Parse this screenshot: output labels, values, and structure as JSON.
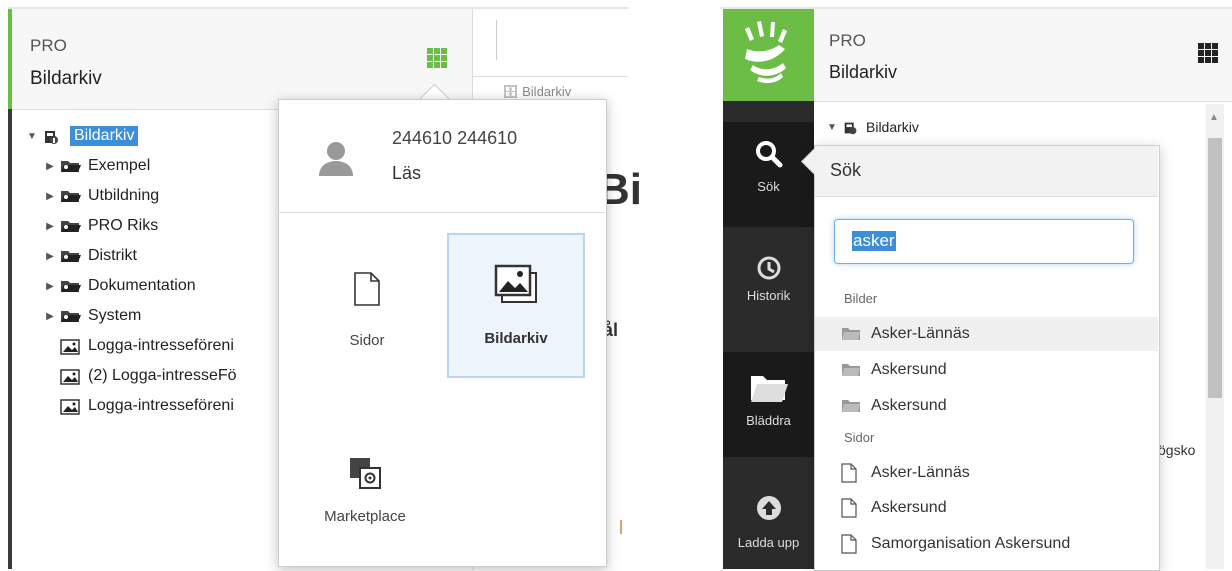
{
  "left": {
    "header": {
      "title": "PRO",
      "subtitle": "Bildarkiv"
    },
    "breadcrumb": "Bildarkiv",
    "tree": {
      "root": "Bildarkiv",
      "folders": [
        "Exempel",
        "Utbildning",
        "PRO Riks",
        "Distrikt",
        "Dokumentation",
        "System"
      ],
      "images": [
        "Logga-intresseföreni",
        "(2) Logga-intresseFö",
        "Logga-intresseföreni"
      ]
    },
    "page_heading_partial": "Bi",
    "table_col_partial": "ål",
    "popover": {
      "user": "244610 244610",
      "role": "Läs",
      "apps": [
        {
          "label": "Sidor",
          "icon": "page-icon",
          "active": false
        },
        {
          "label": "Bildarkiv",
          "icon": "images-icon",
          "active": true
        },
        {
          "label": "Marketplace",
          "icon": "marketplace-icon",
          "active": false
        }
      ]
    }
  },
  "right": {
    "header": {
      "title": "PRO",
      "subtitle": "Bildarkiv"
    },
    "nav": [
      {
        "label": "Sök",
        "icon": "search-icon"
      },
      {
        "label": "Historik",
        "icon": "history-icon"
      },
      {
        "label": "Bläddra",
        "icon": "folder-open-icon"
      },
      {
        "label": "Ladda upp",
        "icon": "upload-icon"
      }
    ],
    "tree_root": "Bildarkiv",
    "partial_text": "ögsko",
    "search": {
      "title": "Sök",
      "value": "asker",
      "images_label": "Bilder",
      "image_results": [
        "Asker-Lännäs",
        "Askersund",
        "Askersund"
      ],
      "pages_label": "Sidor",
      "page_results": [
        "Asker-Lännäs",
        "Askersund",
        "Samorganisation Askersund"
      ]
    }
  },
  "colors": {
    "green": "#6cbd45",
    "blue": "#3c8ed8",
    "dark": "#2b2b2b"
  }
}
